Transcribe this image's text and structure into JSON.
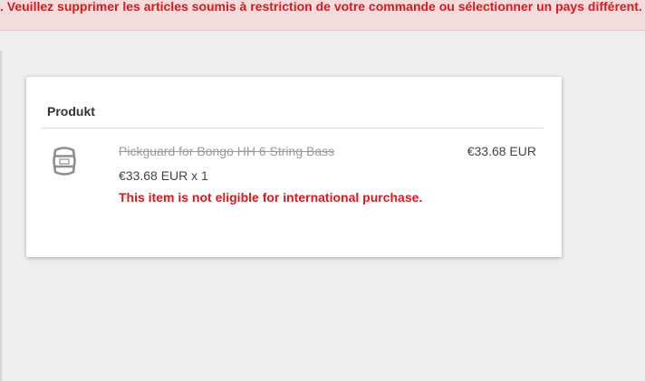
{
  "banner": {
    "message": ". Veuillez supprimer les articles soumis à restriction de votre commande ou sélectionner un pays différent. Clique"
  },
  "cart": {
    "header": "Produkt",
    "items": [
      {
        "title": "Pickguard for Bongo HH 6 String Bass",
        "price": "€33.68 EUR",
        "quantity_line": "€33.68 EUR x 1",
        "error": "This item is not eligible for international purchase.",
        "thumbnail_icon": "pickguard-thumbnail-icon"
      }
    ]
  },
  "colors": {
    "error_red": "#e0161b",
    "banner_bg": "#f5dcdc",
    "page_bg": "#eeeeee"
  }
}
